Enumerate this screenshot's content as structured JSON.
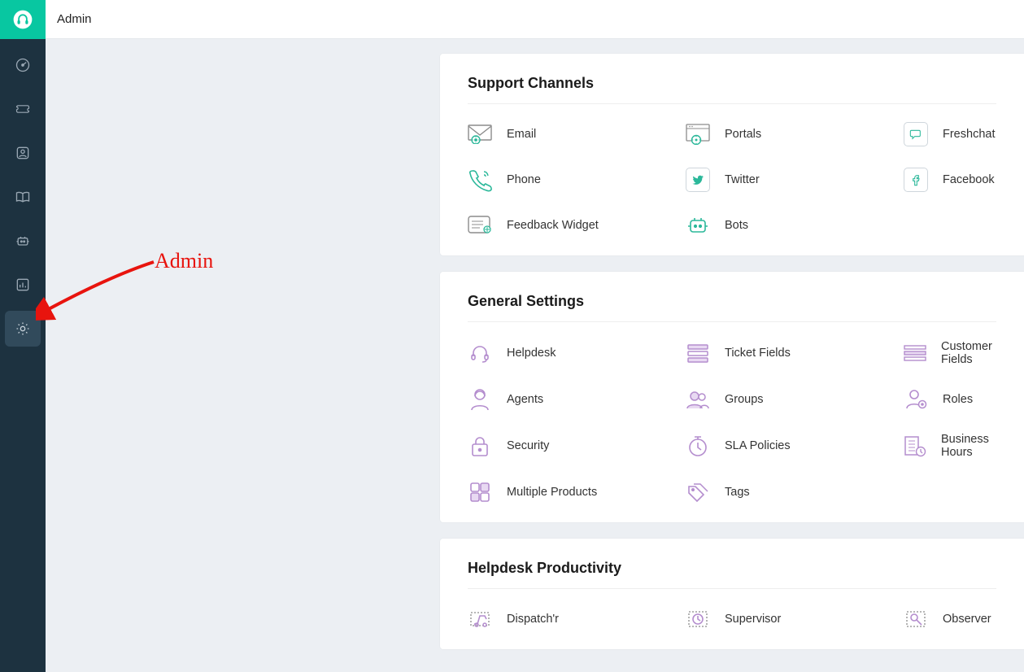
{
  "header": {
    "title": "Admin"
  },
  "annotation": {
    "label": "Admin"
  },
  "sections": {
    "support": {
      "title": "Support Channels",
      "items": {
        "email": "Email",
        "portals": "Portals",
        "freshchat": "Freshchat",
        "phone": "Phone",
        "twitter": "Twitter",
        "facebook": "Facebook",
        "feedback": "Feedback Widget",
        "bots": "Bots"
      }
    },
    "general": {
      "title": "General Settings",
      "items": {
        "helpdesk": "Helpdesk",
        "ticket_fields": "Ticket Fields",
        "customer_fields": "Customer Fields",
        "agents": "Agents",
        "groups": "Groups",
        "roles": "Roles",
        "security": "Security",
        "sla": "SLA Policies",
        "business_hours": "Business Hours",
        "multiple_products": "Multiple Products",
        "tags": "Tags"
      }
    },
    "productivity": {
      "title": "Helpdesk Productivity",
      "items": {
        "dispatchr": "Dispatch'r",
        "supervisor": "Supervisor",
        "observer": "Observer"
      }
    }
  }
}
